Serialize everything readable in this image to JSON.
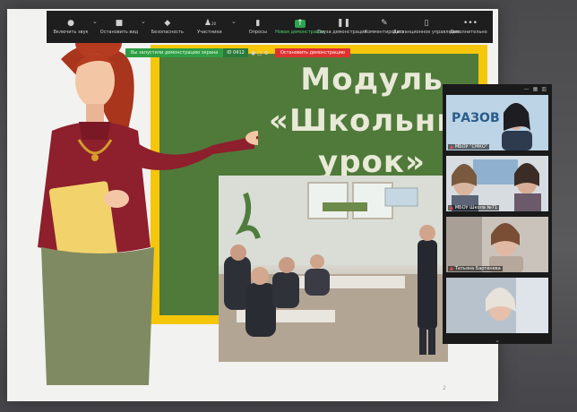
{
  "toolbar": {
    "items": [
      {
        "label": "Включить звук",
        "icon": "mic-icon"
      },
      {
        "label": "Остановить вид",
        "icon": "video-icon"
      },
      {
        "label": "Безопасность",
        "icon": "shield-icon"
      },
      {
        "label": "Участники",
        "icon": "participants-icon",
        "count": "20"
      },
      {
        "label": "Опросы",
        "icon": "polls-icon"
      },
      {
        "label": "Новая демонстрация",
        "icon": "share-icon"
      },
      {
        "label": "Пауза демонстрации",
        "icon": "pause-icon"
      },
      {
        "label": "Комментировать",
        "icon": "pencil-icon"
      },
      {
        "label": "Дистанционное управление",
        "icon": "remote-control-icon"
      },
      {
        "label": "Дополнительно",
        "icon": "more-icon"
      }
    ]
  },
  "share_bar": {
    "status": "Вы запустили демонстрацию экрана",
    "meeting_id": "ID 0412",
    "stop_label": "Остановить демонстрацию"
  },
  "slide": {
    "title_line1": "Модуль",
    "title_line2": "«Школьный",
    "title_line3": "урок»"
  },
  "participants": [
    {
      "name": "МБОУ \"СМКО\""
    },
    {
      "name": "МБОУ Школа №71"
    },
    {
      "name": "Татьяна Бартенева"
    },
    {
      "name": ""
    }
  ],
  "page_number": "2",
  "colors": {
    "toolbar": "#1e1e1f",
    "share_green": "#2f9e44",
    "stop_red": "#e03131",
    "board_frame": "#f5c60a",
    "board_green": "#4f7a3a"
  }
}
